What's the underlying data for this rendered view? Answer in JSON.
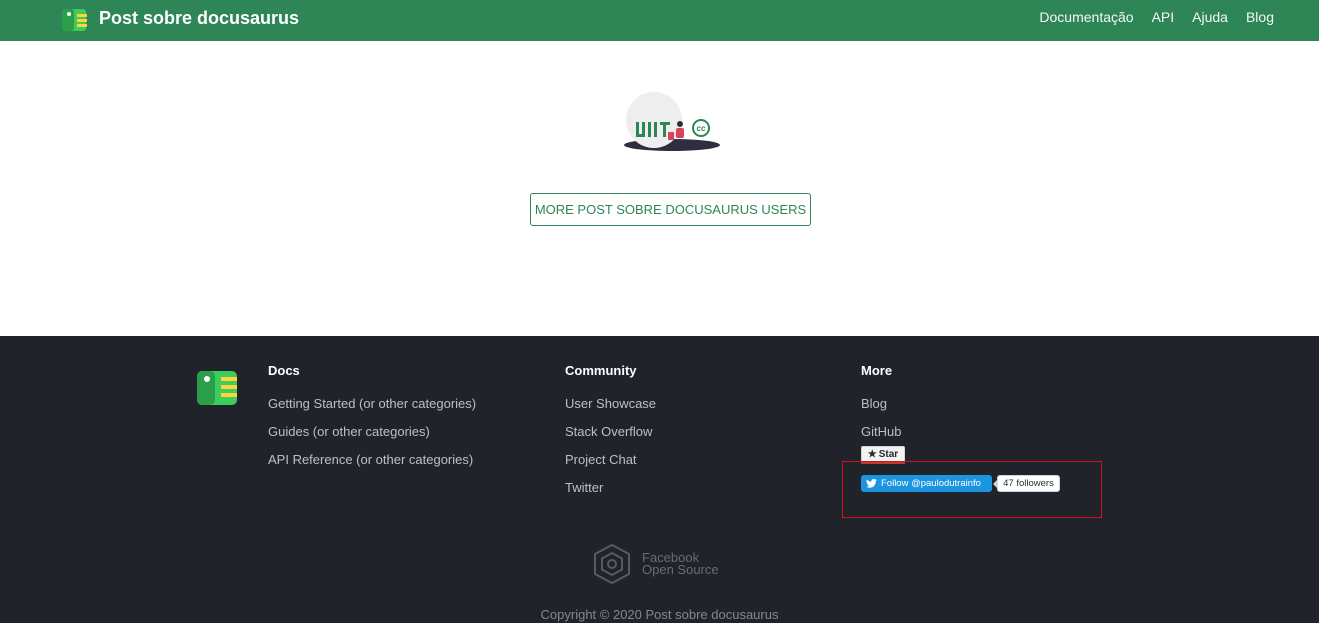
{
  "header": {
    "title": "Post sobre docusaurus",
    "nav": [
      "Documentação",
      "API",
      "Ajuda",
      "Blog"
    ]
  },
  "main": {
    "more_users_button": "MORE POST SOBRE DOCUSAURUS USERS"
  },
  "footer": {
    "docs": {
      "heading": "Docs",
      "links": [
        "Getting Started (or other categories)",
        "Guides (or other categories)",
        "API Reference (or other categories)"
      ]
    },
    "community": {
      "heading": "Community",
      "links": [
        "User Showcase",
        "Stack Overflow",
        "Project Chat",
        "Twitter"
      ]
    },
    "more": {
      "heading": "More",
      "links": [
        "Blog",
        "GitHub"
      ],
      "star_label": "Star",
      "twitter_follow": "Follow @paulodutrainfo",
      "twitter_followers": "47 followers"
    },
    "fb_open_source": [
      "Facebook",
      "Open Source"
    ],
    "copyright": "Copyright © 2020 Post sobre docusaurus"
  },
  "colors": {
    "brand": "#2e8555",
    "footer_bg": "#20232a",
    "highlight": "#d0121f",
    "twitter": "#1b95e0"
  }
}
